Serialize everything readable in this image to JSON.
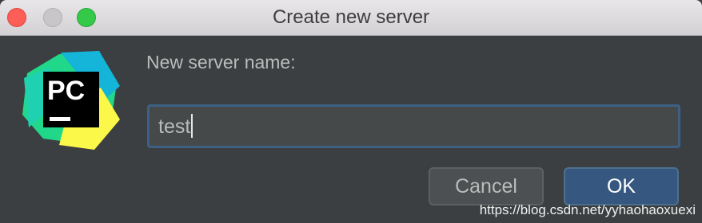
{
  "window": {
    "title": "Create new server"
  },
  "logo": {
    "text": "PC"
  },
  "dialog": {
    "prompt": "New server name:",
    "input_value": "test"
  },
  "buttons": {
    "cancel_label": "Cancel",
    "ok_label": "OK"
  },
  "watermark": {
    "text": "https://blog.csdn.net/yyhaohaoxuexi"
  },
  "colors": {
    "background": "#3c3f41",
    "titlebar": "#dcdadc",
    "field_border": "#3d6185",
    "ok_button": "#365880",
    "close_light": "#fd5e57",
    "zoom_light": "#35c94a"
  },
  "icons": [
    "close-light-icon",
    "minimize-light-icon",
    "zoom-light-icon",
    "pycharm-logo-icon"
  ]
}
